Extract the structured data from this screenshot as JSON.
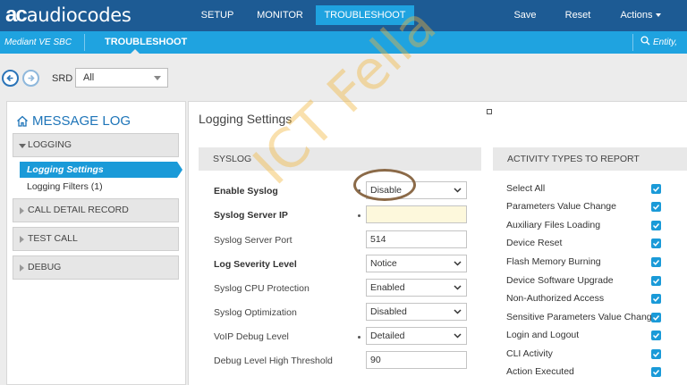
{
  "brand": {
    "mark": "ac",
    "text": "audiocodes"
  },
  "topnav": {
    "setup": "SETUP",
    "monitor": "MONITOR",
    "troubleshoot": "TROUBLESHOOT",
    "save": "Save",
    "reset": "Reset",
    "actions": "Actions"
  },
  "secbar": {
    "device": "Mediant VE SBC",
    "section": "TROUBLESHOOT",
    "search_text": "Entity,"
  },
  "srd": {
    "label": "SRD",
    "value": "All"
  },
  "sidebar": {
    "title": "MESSAGE LOG",
    "logging": "LOGGING",
    "logging_settings": "Logging Settings",
    "logging_filters": "Logging Filters (1)",
    "cdr": "CALL DETAIL RECORD",
    "test_call": "TEST CALL",
    "debug": "DEBUG"
  },
  "main": {
    "title": "Logging Settings",
    "syslog_header": "SYSLOG",
    "activity_header": "ACTIVITY TYPES TO REPORT"
  },
  "syslog": [
    {
      "label": "Enable Syslog",
      "value": "Disable"
    },
    {
      "label": "Syslog Server IP",
      "value": ""
    },
    {
      "label": "Syslog Server Port",
      "value": "514"
    },
    {
      "label": "Log Severity Level",
      "value": "Notice"
    },
    {
      "label": "Syslog CPU Protection",
      "value": "Enabled"
    },
    {
      "label": "Syslog Optimization",
      "value": "Disabled"
    },
    {
      "label": "VoIP Debug Level",
      "value": "Detailed"
    },
    {
      "label": "Debug Level High Threshold",
      "value": "90"
    }
  ],
  "activities": [
    "Select All",
    "Parameters Value Change",
    "Auxiliary Files Loading",
    "Device Reset",
    "Flash Memory Burning",
    "Device Software Upgrade",
    "Non-Authorized Access",
    "Sensitive Parameters Value Change",
    "Login and Logout",
    "CLI Activity",
    "Action Executed"
  ],
  "watermark": "ICT Fella",
  "colors": {
    "topbar": "#1d5b94",
    "accent": "#1fa3e0",
    "active_item": "#1a9ad8",
    "panel": "#e8e8e8"
  }
}
